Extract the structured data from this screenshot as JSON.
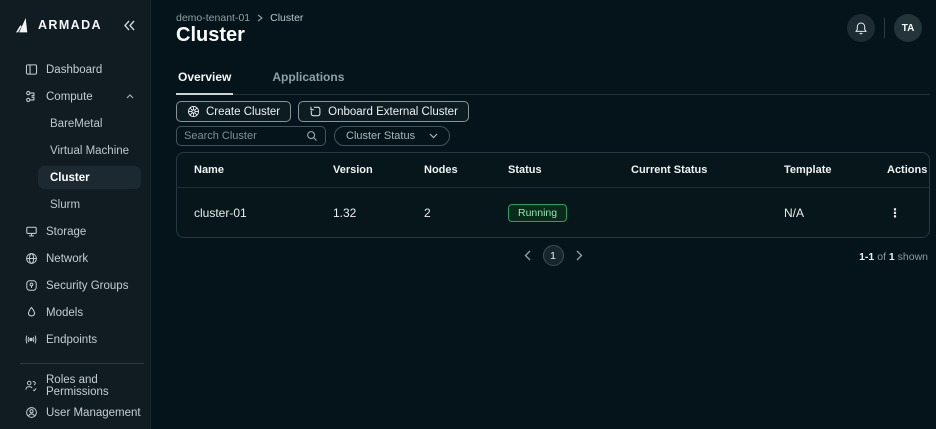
{
  "app": {
    "brand": "ARMADA",
    "icons": [
      "sail-logo-icon",
      "collapse-sidebar-icon",
      "bell-icon",
      "dashboard-icon",
      "compute-icon",
      "storage-icon",
      "network-icon",
      "security-groups-icon",
      "models-icon",
      "endpoints-icon",
      "roles-icon",
      "user-management-icon",
      "helm-icon",
      "import-icon",
      "search-icon",
      "chevron-down-icon",
      "kebab-icon"
    ]
  },
  "sidebar": {
    "items": [
      {
        "label": "Dashboard",
        "icon": "dashboard-icon"
      },
      {
        "label": "Compute",
        "icon": "compute-icon",
        "expanded": true
      },
      {
        "label": "BareMetal"
      },
      {
        "label": "Virtual Machine"
      },
      {
        "label": "Cluster",
        "active": true
      },
      {
        "label": "Slurm"
      },
      {
        "label": "Storage",
        "icon": "storage-icon"
      },
      {
        "label": "Network",
        "icon": "network-icon"
      },
      {
        "label": "Security Groups",
        "icon": "security-groups-icon"
      },
      {
        "label": "Models",
        "icon": "models-icon"
      },
      {
        "label": "Endpoints",
        "icon": "endpoints-icon"
      }
    ],
    "bottom_items": [
      {
        "label": "Roles and Permissions",
        "icon": "roles-icon"
      },
      {
        "label": "User Management",
        "icon": "user-management-icon"
      }
    ]
  },
  "header": {
    "breadcrumb": {
      "tenant": "demo-tenant-01",
      "page": "Cluster"
    },
    "title": "Cluster",
    "avatar_initials": "TA"
  },
  "tabs": {
    "overview": "Overview",
    "applications": "Applications"
  },
  "toolbar": {
    "create_button": "Create Cluster",
    "onboard_button": "Onboard External Cluster",
    "search_placeholder": "Search Cluster",
    "status_filter": "Cluster Status"
  },
  "table": {
    "columns": [
      "Name",
      "Version",
      "Nodes",
      "Status",
      "Current Status",
      "Template",
      "Actions"
    ],
    "rows": [
      {
        "name": "cluster-01",
        "version": "1.32",
        "nodes": "2",
        "status": "Running",
        "current_status": "",
        "template": "N/A"
      }
    ]
  },
  "pagination": {
    "current_page": "1",
    "range": "1-1",
    "of_word": "of",
    "total": "1",
    "shown_word": "shown"
  },
  "colors": {
    "sidebar_bg": "#111b22",
    "main_bg": "#04141a",
    "card_border": "#26393e",
    "status_running_border": "#2d9d5c",
    "status_running_text": "#8ce6ae",
    "status_running_bg": "#0b2a1a",
    "text_primary": "#f2f6f7",
    "text_secondary": "#8fa1a6"
  }
}
